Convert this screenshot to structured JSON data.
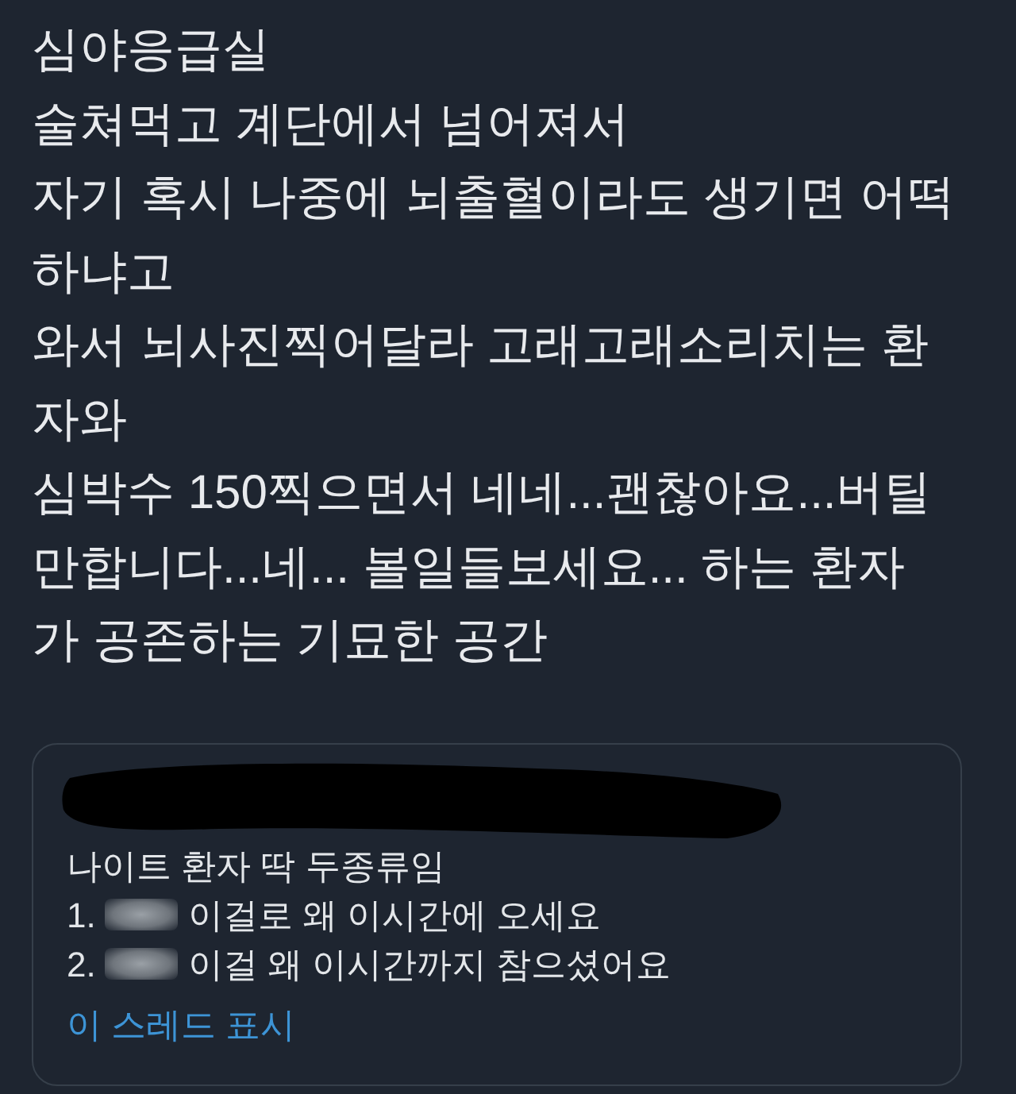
{
  "tweet": {
    "lines": [
      "심야응급실",
      "술쳐먹고 계단에서 넘어져서",
      "자기 혹시 나중에 뇌출혈이라도 생기면 어떡",
      "하냐고",
      "와서 뇌사진찍어달라 고래고래소리치는 환",
      "자와",
      "심박수 150찍으면서 네네...괜찮아요...버틸",
      "만합니다...네... 볼일들보세요... 하는 환자",
      "가 공존하는 기묘한 공간"
    ]
  },
  "quote": {
    "header_redacted": true,
    "lines": [
      {
        "kind": "text",
        "text": "나이트 환자 딱 두종류임"
      },
      {
        "kind": "item",
        "number": "1.",
        "censored": true,
        "text": "이걸로 왜 이시간에 오세요"
      },
      {
        "kind": "item",
        "number": "2.",
        "censored": true,
        "text": "이걸 왜 이시간까지 참으셨어요"
      }
    ],
    "thread_link": "이 스레드 표시"
  }
}
